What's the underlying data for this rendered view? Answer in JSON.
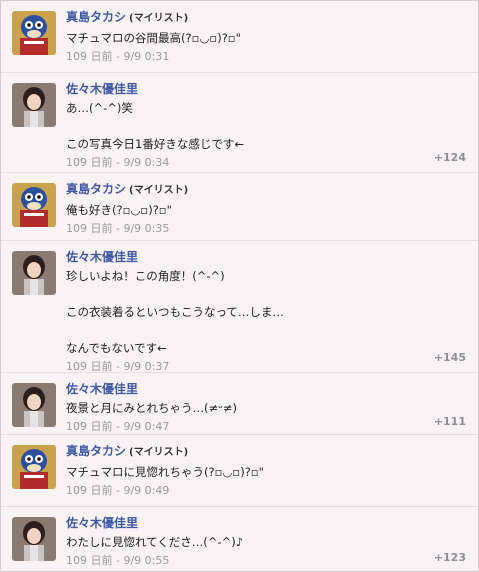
{
  "accounts": {
    "takashi": {
      "name": "真島タカシ",
      "tag": "(マイリスト)"
    },
    "yuka": {
      "name": "佐々木優佳里"
    }
  },
  "posts": [
    {
      "text": "マチュマロの谷間最高(?▫◡▫)?▫\"",
      "time": "109 日前 - 9/9 0:31"
    },
    {
      "text1": "あ…(^-^)笑",
      "text2": "この写真今日1番好きな感じです←",
      "time": "109 日前 - 9/9 0:34",
      "count": "+124"
    },
    {
      "text": "俺も好き(?▫◡▫)?▫\"",
      "time": "109 日前 - 9/9 0:35"
    },
    {
      "text1": "珍しいよね！この角度！(^-^)",
      "text2": "この衣装着るといつもこうなって…しま…",
      "text3": "なんでもないです←",
      "time": "109 日前 - 9/9 0:37",
      "count": "+145"
    },
    {
      "text": "夜景と月にみとれちゃう…(≠ᵕ≠)",
      "time": "109 日前 - 9/9 0:47",
      "count": "+111"
    },
    {
      "text": "マチュマロに見惚れちゃう(?▫◡▫)?▫\"",
      "time": "109 日前 - 9/9 0:49"
    },
    {
      "text": "わたしに見惚れてくださ…(^-^)♪",
      "time": "109 日前 - 9/9 0:55",
      "count": "+123"
    }
  ]
}
